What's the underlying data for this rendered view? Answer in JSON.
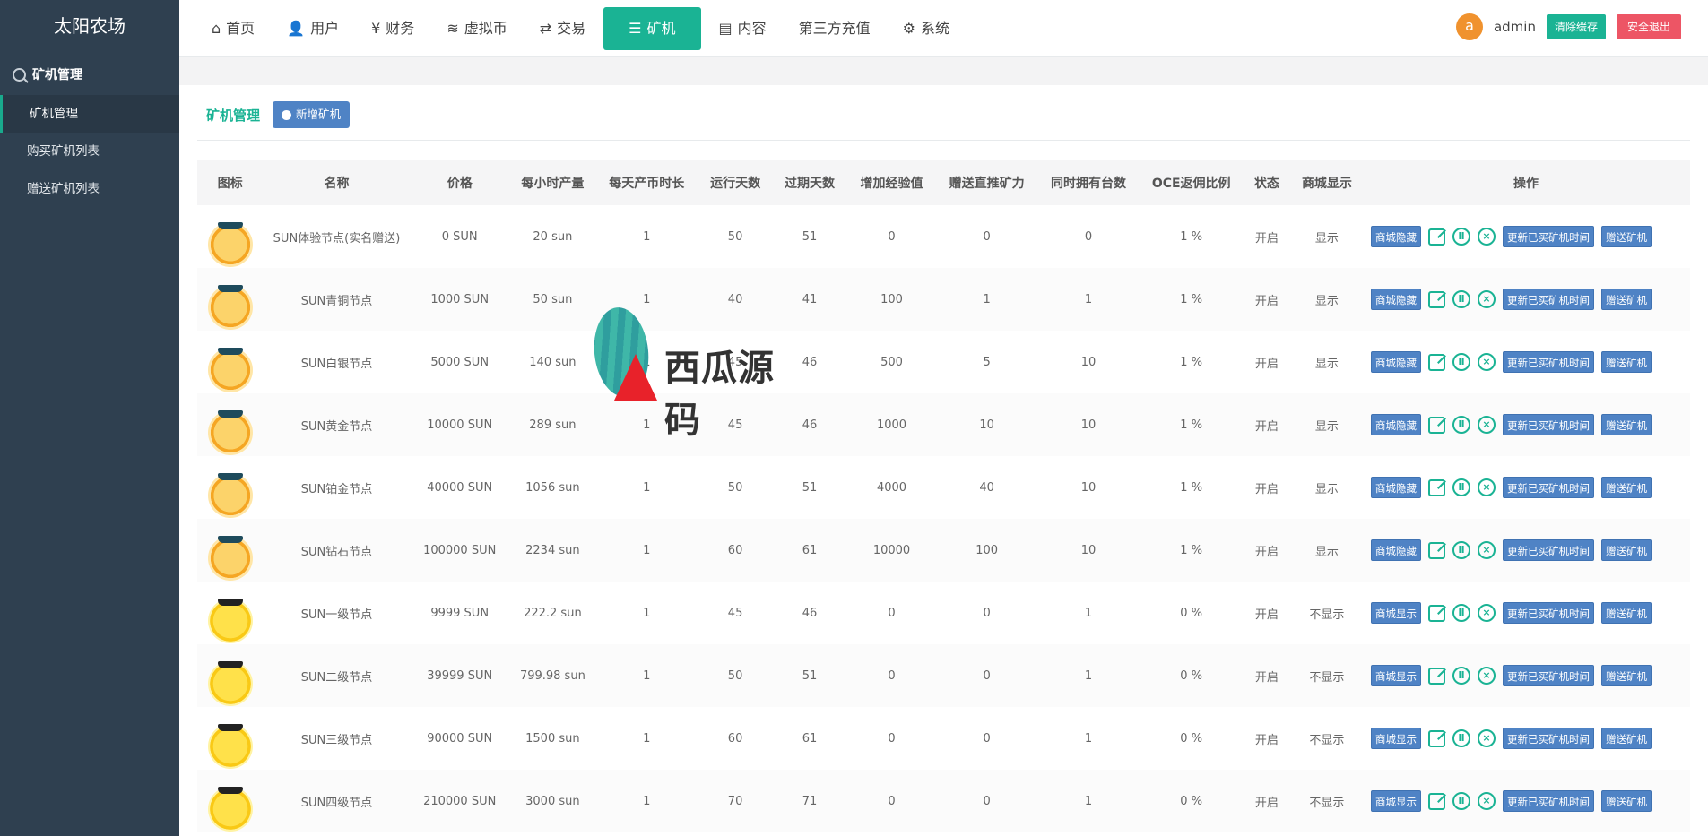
{
  "sidebar": {
    "brand": "太阳农场",
    "section": "矿机管理",
    "items": [
      {
        "label": "矿机管理",
        "active": true
      },
      {
        "label": "购买矿机列表",
        "active": false
      },
      {
        "label": "赠送矿机列表",
        "active": false
      }
    ]
  },
  "topnav": {
    "items": [
      {
        "label": "首页",
        "icon": "home-icon",
        "glyph": "⌂"
      },
      {
        "label": "用户",
        "icon": "user-icon",
        "glyph": "👤"
      },
      {
        "label": "财务",
        "icon": "yen-icon",
        "glyph": "¥"
      },
      {
        "label": "虚拟币",
        "icon": "database-icon",
        "glyph": "≋"
      },
      {
        "label": "交易",
        "icon": "exchange-icon",
        "glyph": "⇄"
      },
      {
        "label": "矿机",
        "icon": "server-icon",
        "glyph": "☰",
        "active": true
      },
      {
        "label": "内容",
        "icon": "document-icon",
        "glyph": "▤"
      },
      {
        "label": "第三方充值",
        "icon": "",
        "glyph": ""
      },
      {
        "label": "系统",
        "icon": "gear-icon",
        "glyph": "⚙"
      }
    ],
    "user": {
      "avatar_letter": "a",
      "name": "admin",
      "clear_cache": "清除缓存",
      "logout": "安全退出"
    }
  },
  "panel": {
    "title": "矿机管理",
    "add_button": "新增矿机"
  },
  "table": {
    "headers": [
      "图标",
      "名称",
      "价格",
      "每小时产量",
      "每天产币时长",
      "运行天数",
      "过期天数",
      "增加经验值",
      "赠送直推矿力",
      "同时拥有台数",
      "OCE返佣比例",
      "状态",
      "商城显示",
      "操作"
    ],
    "action_labels": {
      "edit": "",
      "pause": "Ⅱ",
      "delete": "×",
      "update_time": "更新已买矿机时间",
      "gift": "赠送矿机"
    },
    "rows": [
      {
        "icon": "orange",
        "name": "SUN体验节点(实名赠送)",
        "price": "0 SUN",
        "hourly": "20 sun",
        "daily": "1",
        "run": "50",
        "expire": "51",
        "exp": "0",
        "gift": "0",
        "own": "0",
        "oce": "1 %",
        "status": "开启",
        "shop": "显示",
        "toggle": "商城隐藏"
      },
      {
        "icon": "orange",
        "name": "SUN青铜节点",
        "price": "1000 SUN",
        "hourly": "50 sun",
        "daily": "1",
        "run": "40",
        "expire": "41",
        "exp": "100",
        "gift": "1",
        "own": "1",
        "oce": "1 %",
        "status": "开启",
        "shop": "显示",
        "toggle": "商城隐藏"
      },
      {
        "icon": "orange",
        "name": "SUN白银节点",
        "price": "5000 SUN",
        "hourly": "140 sun",
        "daily": "1",
        "run": "45",
        "expire": "46",
        "exp": "500",
        "gift": "5",
        "own": "10",
        "oce": "1 %",
        "status": "开启",
        "shop": "显示",
        "toggle": "商城隐藏"
      },
      {
        "icon": "orange",
        "name": "SUN黄金节点",
        "price": "10000 SUN",
        "hourly": "289 sun",
        "daily": "1",
        "run": "45",
        "expire": "46",
        "exp": "1000",
        "gift": "10",
        "own": "10",
        "oce": "1 %",
        "status": "开启",
        "shop": "显示",
        "toggle": "商城隐藏"
      },
      {
        "icon": "orange",
        "name": "SUN铂金节点",
        "price": "40000 SUN",
        "hourly": "1056 sun",
        "daily": "1",
        "run": "50",
        "expire": "51",
        "exp": "4000",
        "gift": "40",
        "own": "10",
        "oce": "1 %",
        "status": "开启",
        "shop": "显示",
        "toggle": "商城隐藏"
      },
      {
        "icon": "orange",
        "name": "SUN钻石节点",
        "price": "100000 SUN",
        "hourly": "2234 sun",
        "daily": "1",
        "run": "60",
        "expire": "61",
        "exp": "10000",
        "gift": "100",
        "own": "10",
        "oce": "1 %",
        "status": "开启",
        "shop": "显示",
        "toggle": "商城隐藏"
      },
      {
        "icon": "yellow",
        "name": "SUN一级节点",
        "price": "9999 SUN",
        "hourly": "222.2 sun",
        "daily": "1",
        "run": "45",
        "expire": "46",
        "exp": "0",
        "gift": "0",
        "own": "1",
        "oce": "0 %",
        "status": "开启",
        "shop": "不显示",
        "toggle": "商城显示"
      },
      {
        "icon": "yellow",
        "name": "SUN二级节点",
        "price": "39999 SUN",
        "hourly": "799.98 sun",
        "daily": "1",
        "run": "50",
        "expire": "51",
        "exp": "0",
        "gift": "0",
        "own": "1",
        "oce": "0 %",
        "status": "开启",
        "shop": "不显示",
        "toggle": "商城显示"
      },
      {
        "icon": "yellow",
        "name": "SUN三级节点",
        "price": "90000 SUN",
        "hourly": "1500 sun",
        "daily": "1",
        "run": "60",
        "expire": "61",
        "exp": "0",
        "gift": "0",
        "own": "1",
        "oce": "0 %",
        "status": "开启",
        "shop": "不显示",
        "toggle": "商城显示"
      },
      {
        "icon": "yellow",
        "name": "SUN四级节点",
        "price": "210000 SUN",
        "hourly": "3000 sun",
        "daily": "1",
        "run": "70",
        "expire": "71",
        "exp": "0",
        "gift": "0",
        "own": "1",
        "oce": "0 %",
        "status": "开启",
        "shop": "不显示",
        "toggle": "商城显示"
      }
    ]
  },
  "watermark": {
    "text": "西瓜源码"
  }
}
